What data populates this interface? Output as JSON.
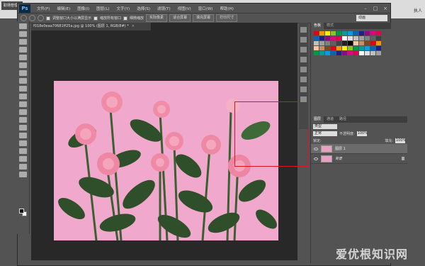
{
  "taskbar": {
    "app_badge": "职场管理",
    "right_text": "执人"
  },
  "menus": [
    "文件(F)",
    "编辑(E)",
    "图像(I)",
    "图层(L)",
    "文字(Y)",
    "选择(S)",
    "滤镜(T)",
    "视图(V)",
    "窗口(W)",
    "帮助(H)"
  ],
  "window_controls": [
    "–",
    "□",
    "×"
  ],
  "options": {
    "chk1_label": "调整窗口大小以满屏显示",
    "chk2_label": "缩放所有窗口",
    "chk3_label": "细微缩放",
    "btn1": "实际像素",
    "btn2": "适合屏幕",
    "btn3": "填充屏幕",
    "btn4": "打印尺寸",
    "workspace": "动画"
  },
  "document": {
    "tab_title": "f018e0eaa70681ff25a.jpg @ 100% (图层 1, RGB/8#) *",
    "close": "×"
  },
  "panels": {
    "swatch_tabs": [
      "色板",
      "样式"
    ],
    "layer_tabs": [
      "图层",
      "通道",
      "路径"
    ],
    "kind_label": "类型",
    "blend_mode": "正常",
    "opacity_label": "不透明度:",
    "opacity_value": "100%",
    "lock_label": "锁定:",
    "fill_label": "填充:",
    "fill_value": "100%",
    "layers": [
      {
        "name": "图层 1",
        "active": true
      },
      {
        "name": "背景",
        "active": false
      }
    ]
  },
  "watermark": "爱优根知识网",
  "colors": {
    "selection": "#e0141e",
    "canvas_bg": "#f0a9cc"
  }
}
